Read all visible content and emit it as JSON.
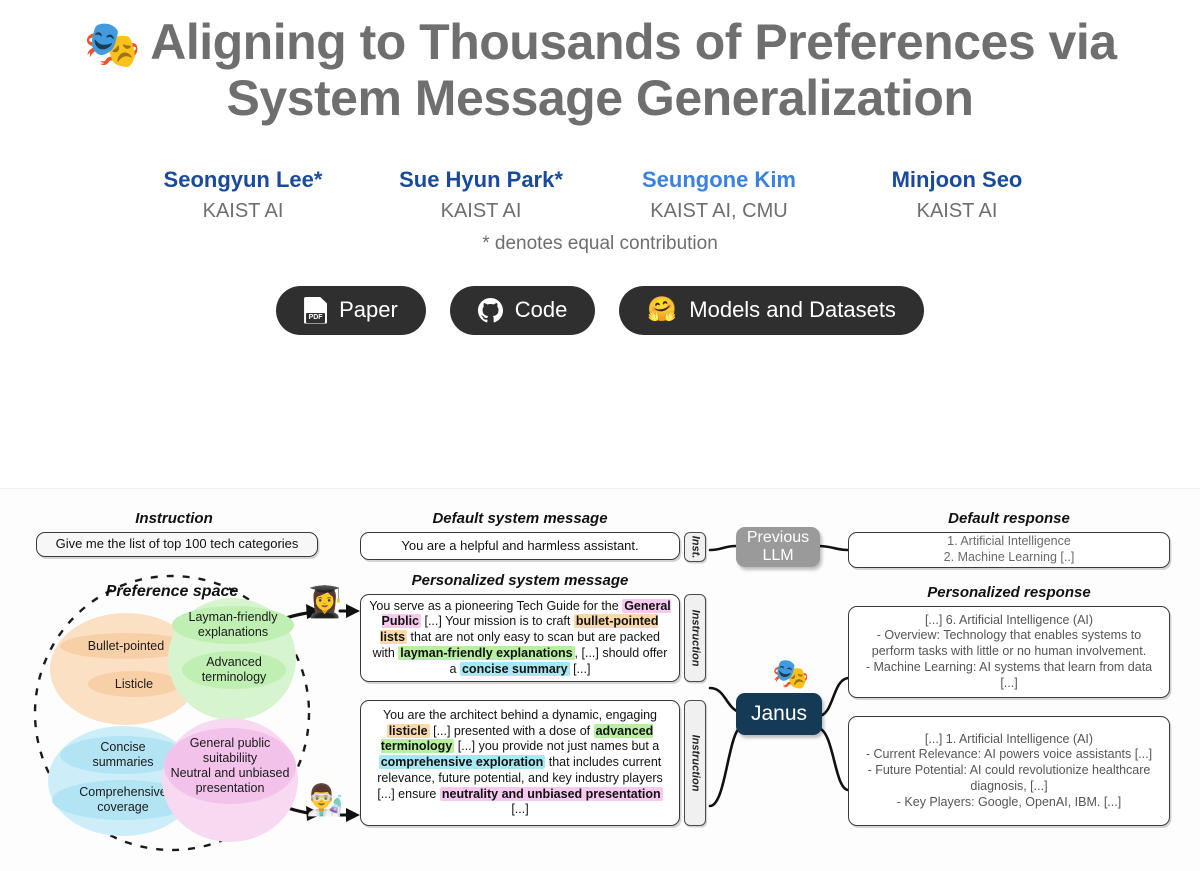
{
  "header": {
    "logo_emoji": "🎭",
    "title_line1": "Aligning to Thousands of Preferences via",
    "title_line2": "System Message Generalization",
    "authors": [
      {
        "name": "Seongyun Lee*",
        "affiliation": "KAIST AI"
      },
      {
        "name": "Sue Hyun Park*",
        "affiliation": "KAIST AI"
      },
      {
        "name": "Seungone Kim",
        "affiliation": "KAIST AI, CMU"
      },
      {
        "name": "Minjoon Seo",
        "affiliation": "KAIST AI"
      }
    ],
    "equal_note": "* denotes equal contribution",
    "buttons": [
      {
        "label": "Paper",
        "icon": "pdf-icon",
        "badge": "PDF"
      },
      {
        "label": "Code",
        "icon": "github-icon"
      },
      {
        "label": "Models and Datasets",
        "icon": "huggingface-icon",
        "emoji": "🤗"
      }
    ]
  },
  "figure": {
    "headings": {
      "instruction": "Instruction",
      "default_system_message": "Default system message",
      "personalized_system_message": "Personalized system message",
      "default_response": "Default response",
      "personalized_response": "Personalized response",
      "preference_space": "Preference space"
    },
    "instruction_text": "Give me the list of top 100 tech categories",
    "default_system_message": "You are a helpful and harmless assistant.",
    "tabs": {
      "short": "Inst.",
      "long": "Instruction"
    },
    "nodes": {
      "previous_llm": "Previous\nLLM",
      "previous_llm_line1": "Previous",
      "previous_llm_line2": "LLM",
      "janus": "Janus",
      "janus_emoji": "🎭"
    },
    "default_response_lines": [
      "1. Artificial Intelligence",
      "2. Machine Learning [..]"
    ],
    "personalized_response_1_lines": [
      "[...] 6. Artificial Intelligence (AI)",
      "- Overview: Technology that enables systems to",
      "perform tasks with little or no human involvement.",
      "- Machine Learning: AI systems that learn from data",
      "[...]"
    ],
    "personalized_response_2_lines": [
      "[...] 1. Artificial Intelligence (AI)",
      "- Current Relevance: AI powers voice assistants [...]",
      "- Future Potential: AI could revolutionize healthcare",
      "diagnosis, [...]",
      "- Key Players: Google, OpenAI, IBM. [...]"
    ],
    "avatars": {
      "student": "👩‍🎓",
      "scientist": "👨‍🔬"
    },
    "preference_blobs": [
      {
        "name": "bullet-pointed-blob",
        "color": "#fbe0c4",
        "inner": "#f8d0a8",
        "items": [
          "Bullet-pointed",
          "Listicle"
        ]
      },
      {
        "name": "layman-blob",
        "color": "#d6f5cf",
        "inner": "#bfefb2",
        "items": [
          "Layman-friendly\nexplanations",
          "Advanced\nterminology"
        ]
      },
      {
        "name": "concise-blob",
        "color": "#cdeef8",
        "inner": "#b2e4f3",
        "items": [
          "Concise\nsummaries",
          "Comprehensive\ncoverage"
        ]
      },
      {
        "name": "general-public-blob",
        "color": "#f7d9f2",
        "inner": "#f2c2ea",
        "items": [
          "General public\nsuitabiliity\nNeutral and unbiased\npresentation"
        ]
      }
    ],
    "blob_text": {
      "bullet_pointed": "Bullet-pointed",
      "listicle": "Listicle",
      "layman_1": "Layman-friendly",
      "layman_2": "explanations",
      "advanced_1": "Advanced",
      "advanced_2": "terminology",
      "concise_1": "Concise",
      "concise_2": "summaries",
      "comprehensive_1": "Comprehensive",
      "comprehensive_2": "coverage",
      "general_1": "General public",
      "general_2": "suitabiliity",
      "general_3": "Neutral and unbiased",
      "general_4": "presentation"
    },
    "sys_msg_1": {
      "t1": "You serve as a pioneering Tech Guide for the ",
      "h1": "General Public",
      "t2": " [...] Your mission is to craft ",
      "h2": "bullet-pointed lists",
      "t3": " that are not only easy to scan but are packed with ",
      "h3": "layman-friendly explanations",
      "t4": ", [...] should offer a ",
      "h4": "concise summary",
      "t5": " [...]"
    },
    "sys_msg_2": {
      "t1": "You are the architect behind a dynamic, engaging ",
      "h1": "listicle",
      "t2": " [...] presented with a dose of ",
      "h2": "advanced terminology",
      "t3": " [...] you provide not just names but a ",
      "h3": "comprehensive exploration",
      "t4": " that includes current relevance, future potential, and key industry players [...] ensure ",
      "h4": "neutrality and unbiased presentation",
      "t5": " [...]"
    }
  },
  "colors": {
    "title_gray": "#6f6f6f",
    "author_blue": "#1b4a9c",
    "author_blue_alt": "#3b82e0",
    "button_dark": "#2f2f2f",
    "janus_navy": "#143a55",
    "prev_llm_gray": "#9a9a9a"
  }
}
